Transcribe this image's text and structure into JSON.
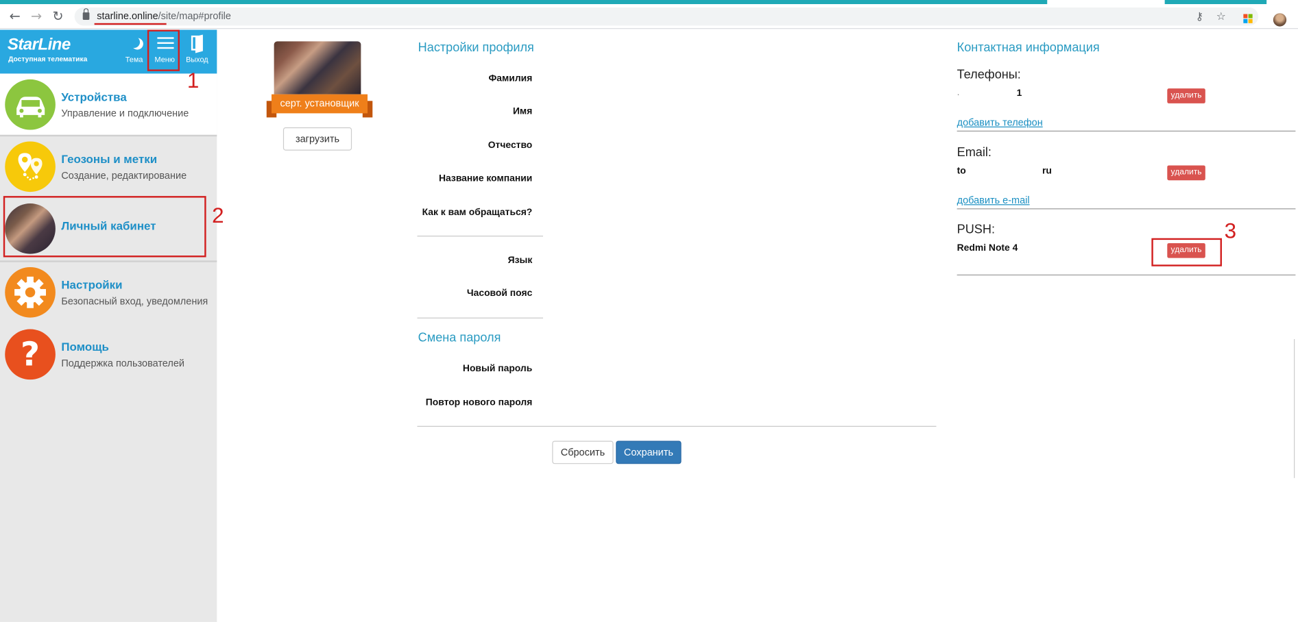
{
  "browser": {
    "url_host": "starline.online",
    "url_path": "/site/map#profile"
  },
  "header": {
    "logo": "StarLine",
    "logo_sub": "Доступная телематика",
    "theme_label": "Тема",
    "menu_label": "Меню",
    "exit_label": "Выход"
  },
  "annotations": [
    "1",
    "2",
    "3"
  ],
  "sidebar": {
    "items": [
      {
        "title": "Устройства",
        "subtitle": "Управление и подключение"
      },
      {
        "title": "Геозоны и метки",
        "subtitle": "Создание, редактирование"
      },
      {
        "title": "Личный кабинет",
        "subtitle": ""
      },
      {
        "title": "Настройки",
        "subtitle": "Безопасный вход, уведомления"
      },
      {
        "title": "Помощь",
        "subtitle": "Поддержка пользователей"
      }
    ]
  },
  "profile": {
    "badge": "серт. установщик",
    "upload_label": "загрузить",
    "settings_title": "Настройки профиля",
    "fields": {
      "last_name": "Фамилия",
      "first_name": "Имя",
      "patronymic": "Отчество",
      "company": "Название компании",
      "address_as": "Как к вам обращаться?",
      "language": "Язык",
      "timezone": "Часовой пояс"
    },
    "password_title": "Смена пароля",
    "new_password": "Новый пароль",
    "repeat_password": "Повтор нового пароля",
    "reset_label": "Сбросить",
    "save_label": "Сохранить"
  },
  "contacts": {
    "title": "Контактная информация",
    "phones_label": "Телефоны:",
    "phone_value_start": ".",
    "phone_value_end": "1",
    "add_phone": "добавить телефон",
    "email_label": "Email:",
    "email_value_start": "to",
    "email_value_end": "ru",
    "add_email": "добавить e-mail",
    "push_label": "PUSH:",
    "push_device": "Redmi Note 4",
    "delete_label": "удалить"
  },
  "colors": {
    "brand": "#29a8e0",
    "title_blue": "#2a9bc2",
    "danger": "#d9534f",
    "primary": "#337ab7",
    "annotation": "#d21f1f",
    "cert_orange": "#ef7f1a"
  }
}
